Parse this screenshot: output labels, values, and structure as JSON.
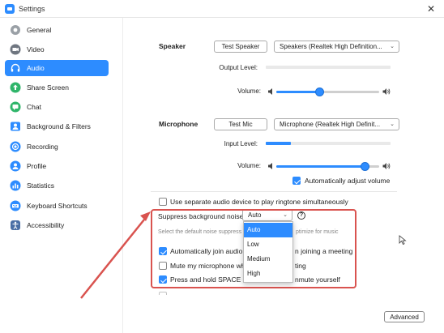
{
  "window": {
    "title": "Settings",
    "close_glyph": "✕"
  },
  "sidebar": {
    "items": [
      {
        "label": "General",
        "icon": "gear-icon"
      },
      {
        "label": "Video",
        "icon": "video-camera-icon"
      },
      {
        "label": "Audio",
        "icon": "headphones-icon",
        "active": true
      },
      {
        "label": "Share Screen",
        "icon": "share-screen-icon"
      },
      {
        "label": "Chat",
        "icon": "chat-bubble-icon"
      },
      {
        "label": "Background & Filters",
        "icon": "person-background-icon"
      },
      {
        "label": "Recording",
        "icon": "record-icon"
      },
      {
        "label": "Profile",
        "icon": "profile-icon"
      },
      {
        "label": "Statistics",
        "icon": "statistics-icon"
      },
      {
        "label": "Keyboard Shortcuts",
        "icon": "keyboard-icon"
      },
      {
        "label": "Accessibility",
        "icon": "accessibility-icon"
      }
    ],
    "accent": "#2d8cff"
  },
  "speaker": {
    "section_title": "Speaker",
    "test_button": "Test Speaker",
    "device": "Speakers (Realtek High Definition...",
    "output_level_label": "Output Level:",
    "output_level": 0.0,
    "volume_label": "Volume:",
    "volume": 0.42
  },
  "microphone": {
    "section_title": "Microphone",
    "test_button": "Test Mic",
    "device": "Microphone (Realtek High Definit...",
    "input_level_label": "Input Level:",
    "input_level": 0.2,
    "volume_label": "Volume:",
    "volume": 0.86,
    "auto_adjust_label": "Automatically adjust volume",
    "auto_adjust": true
  },
  "options": {
    "separate_device_label": "Use separate audio device to play ringtone simultaneously",
    "separate_device": false,
    "suppress_label": "Suppress background noise",
    "suppress_value": "Auto",
    "suppress_hint_left": "Select the default noise suppress",
    "suppress_hint_right": "ptimize for music",
    "auto_join_label_left": "Automatically join audio",
    "auto_join_label_right": "n joining a meeting",
    "auto_join": true,
    "mute_label_left": "Mute my microphone wh",
    "mute_label_right": "ting",
    "mute": false,
    "space_label_left": "Press and hold SPACE ke",
    "space_label_right": "nmute yourself",
    "space": true
  },
  "dropdown": {
    "options": [
      "Auto",
      "Low",
      "Medium",
      "High"
    ],
    "selected": "Auto"
  },
  "footer": {
    "advanced_button": "Advanced"
  },
  "annotation_color": "#d9534f"
}
